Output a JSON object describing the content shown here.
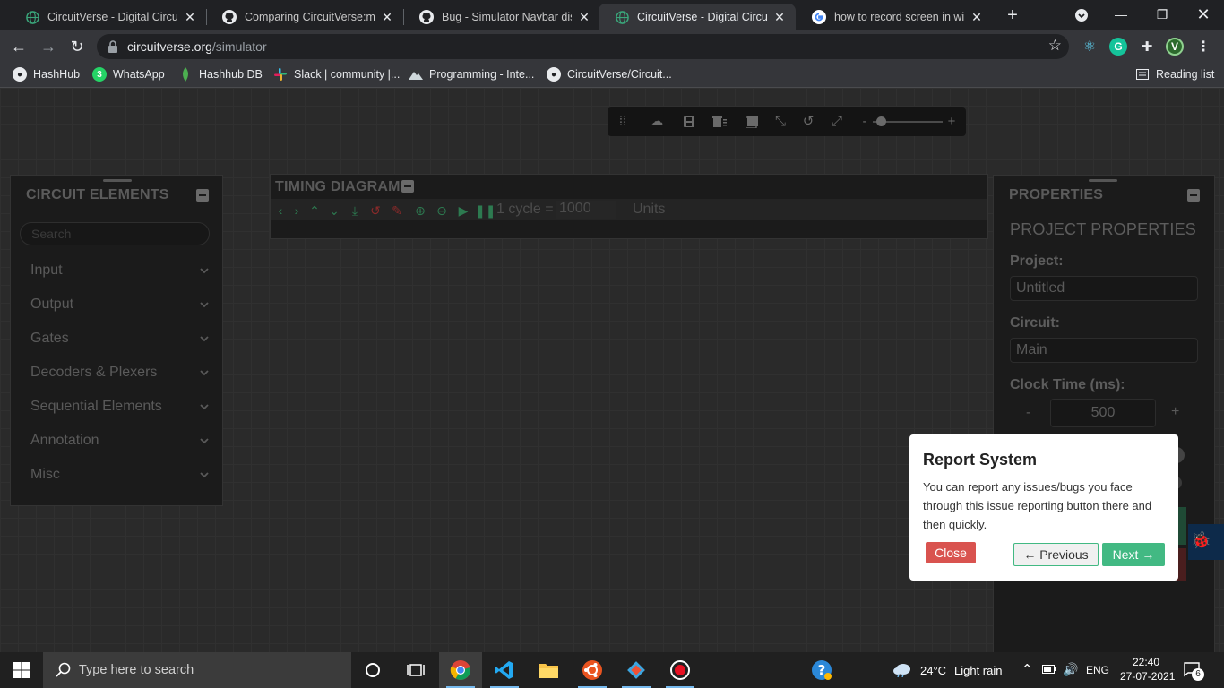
{
  "browser": {
    "tabs": [
      {
        "title": "CircuitVerse - Digital Circuit S",
        "icon": "globe-icon",
        "active": false
      },
      {
        "title": "Comparing CircuitVerse:maste",
        "icon": "github-icon",
        "active": false
      },
      {
        "title": "Bug - Simulator Navbar disap",
        "icon": "github-icon",
        "active": false
      },
      {
        "title": "CircuitVerse - Digital Circuit S",
        "icon": "globe-icon",
        "active": true
      },
      {
        "title": "how to record screen in wind",
        "icon": "google-icon",
        "active": false
      }
    ],
    "url_domain": "circuitverse.org",
    "url_path": "/simulator",
    "extension_profile_letter": "V",
    "bookmarks": [
      {
        "label": "HashHub",
        "icon": "github-icon"
      },
      {
        "label": "WhatsApp",
        "icon": "whatsapp-icon",
        "badge": "3"
      },
      {
        "label": "Hashhub DB",
        "icon": "leaf-icon"
      },
      {
        "label": "Slack | community |...",
        "icon": "slack-icon"
      },
      {
        "label": "Programming - Inte...",
        "icon": "mountain-icon"
      },
      {
        "label": "CircuitVerse/Circuit...",
        "icon": "github-icon"
      }
    ],
    "reading_list": "Reading list"
  },
  "simulator": {
    "circuit_elements": {
      "title": "CIRCUIT ELEMENTS",
      "search_placeholder": "Search",
      "categories": [
        "Input",
        "Output",
        "Gates",
        "Decoders & Plexers",
        "Sequential Elements",
        "Annotation",
        "Misc"
      ]
    },
    "timing_diagram": {
      "title": "TIMING DIAGRAM",
      "cycle_label": "1 cycle =",
      "cycle_value": "1000",
      "units_label": "Units"
    },
    "properties": {
      "title": "PROPERTIES",
      "subtitle": "PROJECT PROPERTIES",
      "project_label": "Project:",
      "project_value": "Untitled",
      "circuit_label": "Circuit:",
      "circuit_value": "Main",
      "clock_label": "Clock Time (ms):",
      "clock_value": "500",
      "minus": "-",
      "plus": "+"
    },
    "popover": {
      "title": "Report System",
      "text": "You can report any issues/bugs you face through this issue reporting button there and then quickly.",
      "close_label": "Close",
      "prev_label": "← Previous",
      "next_label": "Next →"
    }
  },
  "taskbar": {
    "search_placeholder": "Type here to search",
    "weather_temp": "24°C",
    "weather_desc": "Light rain",
    "language": "ENG",
    "time": "22:40",
    "date": "27-07-2021",
    "notification_count": "6"
  },
  "colors": {
    "accent_green": "#42b983",
    "close_red": "#d9534f",
    "chrome_dark": "#202124",
    "chrome_toolbar": "#35363a"
  }
}
